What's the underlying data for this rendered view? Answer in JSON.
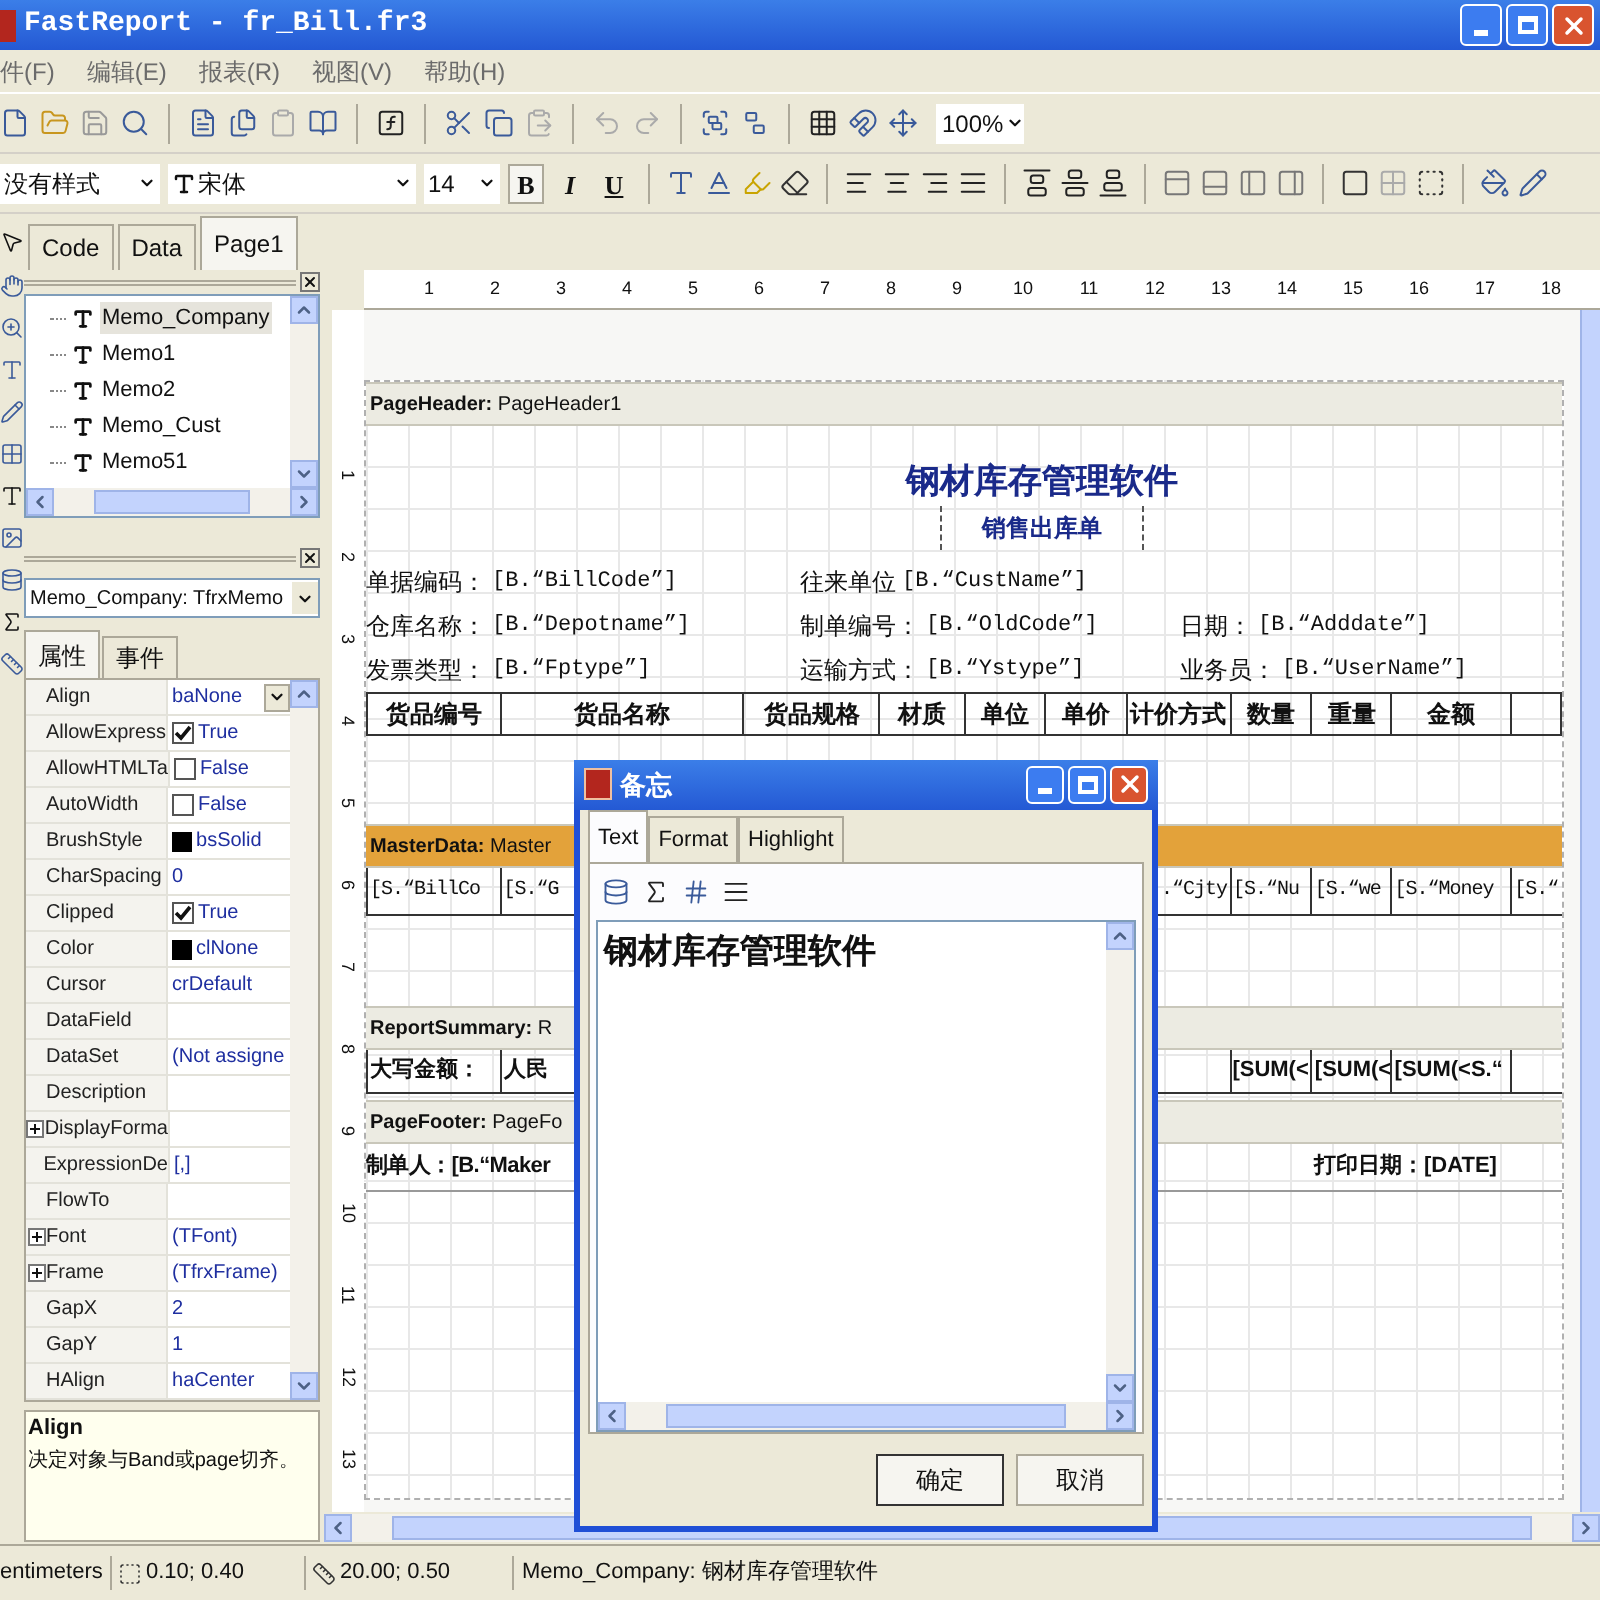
{
  "window": {
    "title": "FastReport - fr_Bill.fr3"
  },
  "menu": [
    "件(F)",
    "编辑(E)",
    "报表(R)",
    "视图(V)",
    "帮助(H)"
  ],
  "toolbar": {
    "zoom": "100%"
  },
  "format_bar": {
    "style": "没有样式",
    "font": "宋体",
    "size": "14",
    "buttons": [
      {
        "label": "B",
        "selected": true
      },
      {
        "label": "I",
        "selected": false
      },
      {
        "label": "U",
        "selected": false
      }
    ]
  },
  "tabs": [
    {
      "label": "Code",
      "selected": false
    },
    {
      "label": "Data",
      "selected": false
    },
    {
      "label": "Page1",
      "selected": true
    }
  ],
  "report_tree": {
    "items": [
      {
        "label": "Memo_Company",
        "selected": true
      },
      {
        "label": "Memo1",
        "selected": false
      },
      {
        "label": "Memo2",
        "selected": false
      },
      {
        "label": "Memo_Cust",
        "selected": false
      },
      {
        "label": "Memo51",
        "selected": false
      }
    ]
  },
  "inspector": {
    "object": "Memo_Company: TfrxMemo",
    "tabs": [
      {
        "label": "属性",
        "selected": true
      },
      {
        "label": "事件",
        "selected": false
      }
    ],
    "properties": [
      {
        "name": "Align",
        "kind": "dropdown",
        "value": "baNone"
      },
      {
        "name": "AllowExpress",
        "kind": "checkbox",
        "checked": true,
        "value": "True"
      },
      {
        "name": "AllowHTMLTa",
        "kind": "checkbox",
        "checked": false,
        "value": "False"
      },
      {
        "name": "AutoWidth",
        "kind": "checkbox",
        "checked": false,
        "value": "False"
      },
      {
        "name": "BrushStyle",
        "kind": "swatch",
        "value": "bsSolid"
      },
      {
        "name": "CharSpacing",
        "kind": "text",
        "value": "0"
      },
      {
        "name": "Clipped",
        "kind": "checkbox",
        "checked": true,
        "value": "True"
      },
      {
        "name": "Color",
        "kind": "swatch",
        "value": "clNone"
      },
      {
        "name": "Cursor",
        "kind": "text",
        "value": "crDefault"
      },
      {
        "name": "DataField",
        "kind": "text"
      },
      {
        "name": "DataSet",
        "kind": "text",
        "value": "(Not assigne"
      },
      {
        "name": "Description",
        "kind": "text"
      },
      {
        "name": "DisplayForma",
        "kind": "text",
        "expanded": false
      },
      {
        "name": "ExpressionDe",
        "kind": "text",
        "value": "[,]"
      },
      {
        "name": "FlowTo",
        "kind": "text"
      },
      {
        "name": "Font",
        "kind": "text",
        "expanded": false,
        "value": "(TFont)"
      },
      {
        "name": "Frame",
        "kind": "text",
        "expanded": false,
        "value": "(TfrxFrame)"
      },
      {
        "name": "GapX",
        "kind": "text",
        "value": "2"
      },
      {
        "name": "GapY",
        "kind": "text",
        "value": "1"
      },
      {
        "name": "HAlign",
        "kind": "text",
        "value": "haCenter"
      }
    ],
    "description": {
      "title": "Align",
      "text": "决定对象与Band或page切齐。"
    }
  },
  "rulers": {
    "horizontal": [
      "1",
      "2",
      "3",
      "4",
      "5",
      "6",
      "7",
      "8",
      "9",
      "10",
      "11",
      "12",
      "13",
      "14",
      "15",
      "16",
      "17",
      "18"
    ],
    "vertical": [
      "1",
      "2",
      "3",
      "4",
      "5",
      "6",
      "7",
      "8",
      "9",
      "10",
      "11",
      "12",
      "13"
    ]
  },
  "report": {
    "page_header": {
      "band": "**PageHeader:** PageHeader1",
      "title": "钢材库存管理软件",
      "subtitle": "销售出库单",
      "field_columns": [
        [
          {
            "label": "单据编码：",
            "value": "[B.“BillCode”]"
          },
          {
            "label": "仓库名称：",
            "value": "[B.“Depotname”]"
          },
          {
            "label": "发票类型：",
            "value": "[B.“Fptype”]"
          }
        ],
        [
          {
            "label": "往来单位",
            "value": "[B.“CustName”]"
          },
          {
            "label": "制单编号：",
            "value": "[B.“OldCode”]"
          },
          {
            "label": "运输方式：",
            "value": "[B.“Ystype”]"
          }
        ],
        [
          {
            "label": "日期：",
            "value": "[B.“Adddate”]"
          },
          {
            "label": "业务员：",
            "value": "[B.“UserName”]"
          }
        ]
      ],
      "table_columns": [
        "货品编号",
        "货品名称",
        "货品规格",
        "材质",
        "单位",
        "单价",
        "计价方式",
        "数量",
        "重量",
        "金额"
      ]
    },
    "master_data": {
      "band": "**MasterData:** Master",
      "cells_left": [
        "[S.“BillCo",
        "[S.“G"
      ],
      "cells_right": [
        ".“Cjty",
        "[S.“Nu",
        "[S.“we",
        "[S.“Money",
        "[S.“"
      ]
    },
    "report_summary": {
      "band": "**ReportSummary:** R",
      "cells_left": [
        "大写金额：",
        "人民"
      ],
      "cells_right": [
        "[SUM(<",
        "[SUM(<",
        "[SUM(<S.“"
      ]
    },
    "page_footer": {
      "band": "**PageFooter:** PageFo",
      "left": "制单人：[B.“Maker",
      "right": "打印日期：[DATE]"
    }
  },
  "dialog": {
    "title": "备忘",
    "tabs": [
      {
        "label": "Text",
        "selected": true
      },
      {
        "label": "Format",
        "selected": false
      },
      {
        "label": "Highlight",
        "selected": false
      }
    ],
    "text": "钢材库存管理软件",
    "buttons": [
      "确定",
      "取消"
    ]
  },
  "status_bar": [
    "entimeters",
    "0.10; 0.40",
    "20.00; 0.50",
    "Memo_Company: 钢材库存管理软件"
  ]
}
